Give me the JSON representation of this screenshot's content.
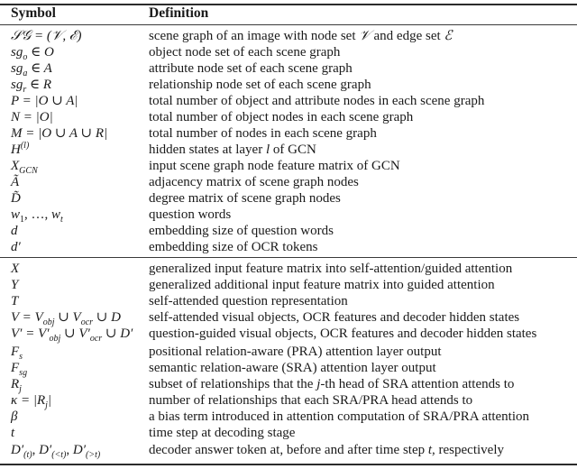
{
  "header": {
    "symbol": "Symbol",
    "definition": "Definition"
  },
  "section1": [
    {
      "symbol": "𝒮𝒢 = (𝒱, ℰ)",
      "definition": "scene graph of an image with node set 𝒱 and edge set ℰ"
    },
    {
      "symbol": "sg_o ∈ O",
      "definition": "object node set of each scene graph"
    },
    {
      "symbol": "sg_a ∈ A",
      "definition": "attribute node set of each scene graph"
    },
    {
      "symbol": "sg_r ∈ R",
      "definition": "relationship node set of each scene graph"
    },
    {
      "symbol": "P = |O ∪ A|",
      "definition": "total number of object and attribute nodes in each scene graph"
    },
    {
      "symbol": "N = |O|",
      "definition": "total number of object nodes in each scene graph"
    },
    {
      "symbol": "M = |O ∪ A ∪ R|",
      "definition": "total number of nodes in each scene graph"
    },
    {
      "symbol": "H^(l)",
      "definition": "hidden states at layer l of GCN"
    },
    {
      "symbol": "X_GCN",
      "definition": "input scene graph node feature matrix of GCN"
    },
    {
      "symbol": "Ã",
      "definition": "adjacency matrix of scene graph nodes"
    },
    {
      "symbol": "D̃",
      "definition": "degree matrix of scene graph nodes"
    },
    {
      "symbol": "w_1, …, w_t",
      "definition": "question words"
    },
    {
      "symbol": "d",
      "definition": "embedding size of question words"
    },
    {
      "symbol": "d′",
      "definition": "embedding size of OCR tokens"
    }
  ],
  "section2": [
    {
      "symbol": "X",
      "definition": "generalized input feature matrix into self-attention/guided attention"
    },
    {
      "symbol": "Y",
      "definition": "generalized additional input feature matrix into guided attention"
    },
    {
      "symbol": "T",
      "definition": "self-attended question representation"
    },
    {
      "symbol": "V = V_obj ∪ V_ocr ∪ D",
      "definition": "self-attended visual objects, OCR features and decoder hidden states"
    },
    {
      "symbol": "V′ = V′_obj ∪ V′_ocr ∪ D′",
      "definition": "question-guided visual objects, OCR features and decoder hidden states"
    },
    {
      "symbol": "F_s",
      "definition": "positional relation-aware (PRA) attention layer output"
    },
    {
      "symbol": "F_sg",
      "definition": "semantic relation-aware (SRA) attention layer output"
    },
    {
      "symbol": "R_j",
      "definition": "subset of relationships that the j-th head of SRA attention attends to"
    },
    {
      "symbol": "κ = |R_j|",
      "definition": "number of relationships that each SRA/PRA head attends to"
    },
    {
      "symbol": "β",
      "definition": "a bias term introduced in attention computation of SRA/PRA attention"
    },
    {
      "symbol": "t",
      "definition": "time step at decoding stage"
    },
    {
      "symbol": "D′_(t), D′_(<t), D′_(>t)",
      "definition": "decoder answer token at, before and after time step t, respectively"
    }
  ],
  "def_parts": {
    "sg_pre": "scene graph of an image with node set ",
    "sg_mid": " and edge set ",
    "hidden_pre": "hidden states at layer ",
    "hidden_post": " of GCN",
    "rj_pre": "subset of relationships that the ",
    "rj_post": "-th head of SRA attention attends to",
    "dec_pre": "decoder answer token at, before and after time step ",
    "dec_post": ", respectively",
    "V": "𝒱",
    "E": "ℰ",
    "l": "l",
    "j": "j",
    "t": "t"
  },
  "sym_parts": {
    "SG": "𝒮𝒢 = (𝒱, ℰ)",
    "sg": "sg",
    "o": "o",
    "a": "a",
    "r": "r",
    "inO": " ∈ O",
    "inA": " ∈ A",
    "inR": " ∈ R",
    "P": "P = |O ∪ A|",
    "N": "N = |O|",
    "M": "M = |O ∪ A ∪ R|",
    "H": "H",
    "lsup": "(l)",
    "X": "X",
    "GCN": "GCN",
    "Atilde": "Ã",
    "Dtilde": "D̃",
    "w": "w",
    "one": "1",
    "ellipsis": ", …, ",
    "tsub": "t",
    "d": "d",
    "dprime": "d′",
    "Xs": "X",
    "Y": "Y",
    "T": "T",
    "Veq": "V = V",
    "obj": "obj",
    "cup_V": " ∪ V",
    "ocr": "ocr",
    "cup_D": " ∪ D",
    "Vpeq": "V′ = V′",
    "cup_Vp": " ∪ V′",
    "cup_Dp": " ∪ D′",
    "F": "F",
    "s": "s",
    "sgsub": "sg",
    "R": "R",
    "j": "j",
    "kappa_pre": "κ = |R",
    "bar": "|",
    "beta": "β",
    "t": "t",
    "Dp": "D′",
    "t_paren": "(t)",
    "lt": "(<t)",
    "gt": "(>t)",
    "comma": ", "
  }
}
